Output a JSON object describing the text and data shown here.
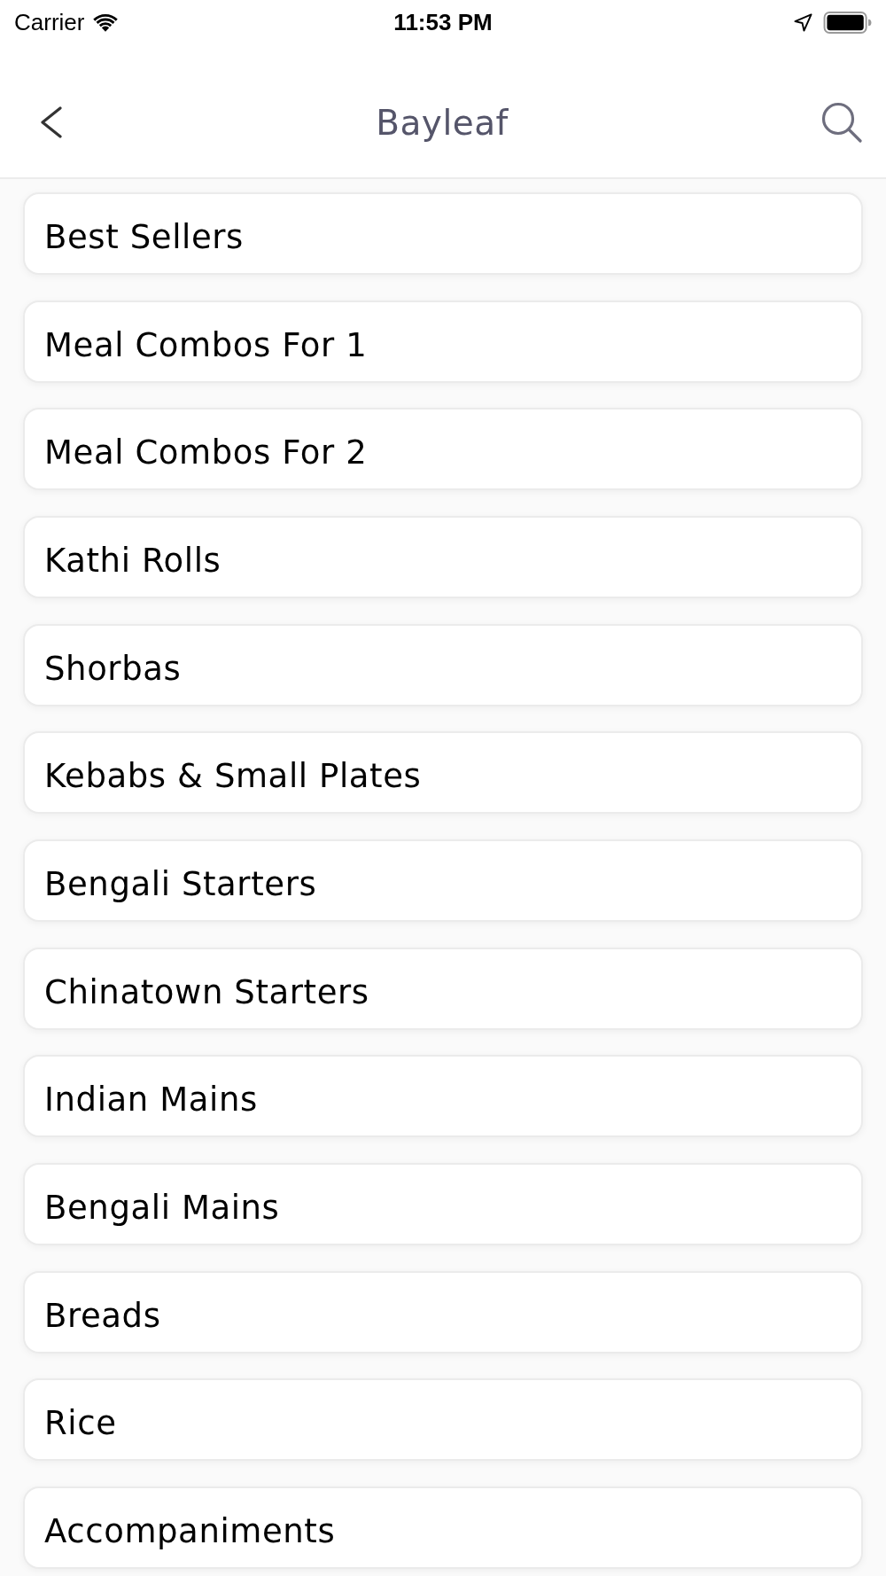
{
  "status_bar": {
    "carrier": "Carrier",
    "time": "11:53 PM"
  },
  "nav_bar": {
    "title": "Bayleaf"
  },
  "categories": [
    "Best Sellers",
    "Meal Combos For 1",
    "Meal Combos For 2",
    "Kathi Rolls",
    "Shorbas",
    "Kebabs & Small Plates",
    "Bengali Starters",
    "Chinatown Starters",
    "Indian Mains",
    "Bengali Mains",
    "Breads",
    "Rice",
    "Accompaniments"
  ]
}
